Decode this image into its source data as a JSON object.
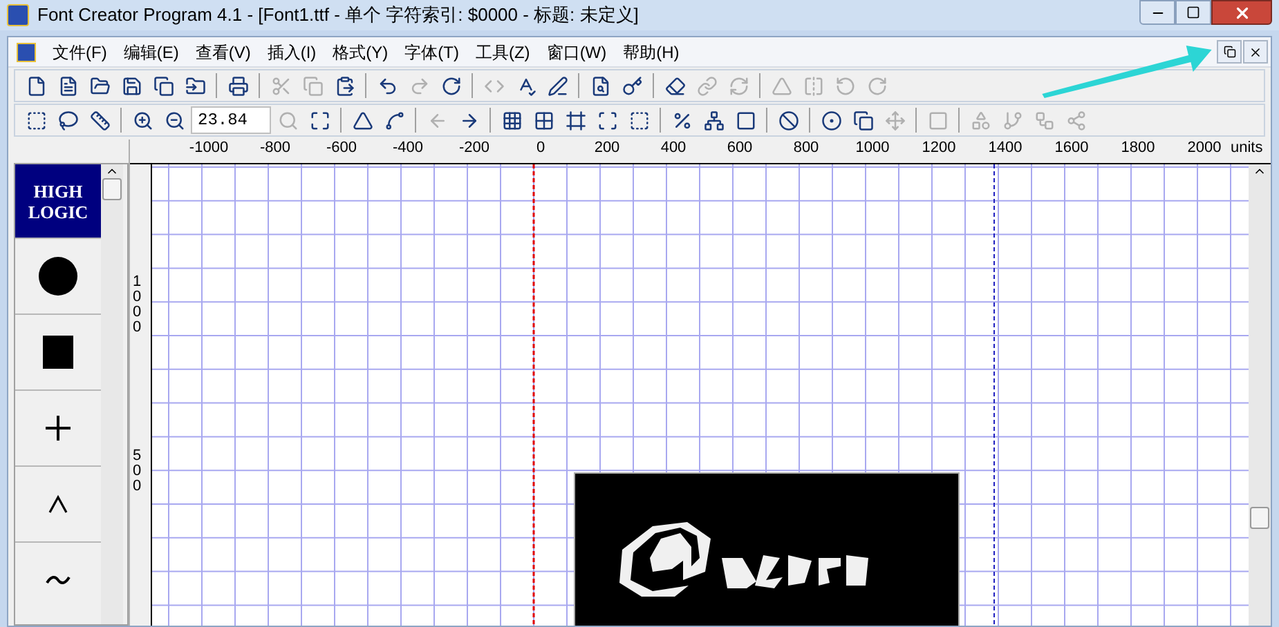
{
  "window": {
    "title": "Font Creator Program 4.1 - [Font1.ttf - 单个 字符索引: $0000 - 标题: 未定义]"
  },
  "menu": [
    "文件(F)",
    "编辑(E)",
    "查看(V)",
    "插入(I)",
    "格式(Y)",
    "字体(T)",
    "工具(Z)",
    "窗口(W)",
    "帮助(H)"
  ],
  "toolbar_1": [
    {
      "kind": "button",
      "disabled": false
    },
    {
      "kind": "button",
      "disabled": false
    },
    {
      "kind": "button",
      "disabled": false
    },
    {
      "kind": "button",
      "disabled": false
    },
    {
      "kind": "button",
      "disabled": false
    },
    {
      "kind": "button",
      "disabled": false
    },
    {
      "kind": "separator"
    },
    {
      "kind": "button",
      "disabled": false
    },
    {
      "kind": "separator"
    },
    {
      "kind": "button",
      "disabled": true
    },
    {
      "kind": "button",
      "disabled": true
    },
    {
      "kind": "button",
      "disabled": false
    },
    {
      "kind": "separator"
    },
    {
      "kind": "button",
      "disabled": false
    },
    {
      "kind": "button",
      "disabled": true
    },
    {
      "kind": "button",
      "disabled": false
    },
    {
      "kind": "separator"
    },
    {
      "kind": "button",
      "disabled": true
    },
    {
      "kind": "button",
      "disabled": false
    },
    {
      "kind": "button",
      "disabled": false
    },
    {
      "kind": "separator"
    },
    {
      "kind": "button",
      "disabled": false
    },
    {
      "kind": "button",
      "disabled": false
    },
    {
      "kind": "separator"
    },
    {
      "kind": "button",
      "disabled": false
    },
    {
      "kind": "button",
      "disabled": true
    },
    {
      "kind": "button",
      "disabled": true
    },
    {
      "kind": "separator"
    },
    {
      "kind": "button",
      "disabled": true
    },
    {
      "kind": "button",
      "disabled": true
    },
    {
      "kind": "button",
      "disabled": true
    },
    {
      "kind": "button",
      "disabled": true
    }
  ],
  "toolbar_2": [
    {
      "kind": "button",
      "disabled": false
    },
    {
      "kind": "button",
      "disabled": false
    },
    {
      "kind": "button",
      "disabled": false
    },
    {
      "kind": "separator"
    },
    {
      "kind": "button",
      "disabled": false
    },
    {
      "kind": "button",
      "disabled": false
    },
    {
      "kind": "field",
      "value": "23.84"
    },
    {
      "kind": "button",
      "disabled": true
    },
    {
      "kind": "button",
      "disabled": false
    },
    {
      "kind": "separator"
    },
    {
      "kind": "button",
      "disabled": false
    },
    {
      "kind": "button",
      "disabled": false
    },
    {
      "kind": "separator"
    },
    {
      "kind": "button",
      "disabled": true
    },
    {
      "kind": "button",
      "disabled": false
    },
    {
      "kind": "separator"
    },
    {
      "kind": "button",
      "disabled": false
    },
    {
      "kind": "button",
      "disabled": false
    },
    {
      "kind": "button",
      "disabled": false
    },
    {
      "kind": "button",
      "disabled": false
    },
    {
      "kind": "button",
      "disabled": false
    },
    {
      "kind": "separator"
    },
    {
      "kind": "button",
      "disabled": false
    },
    {
      "kind": "button",
      "disabled": false
    },
    {
      "kind": "button",
      "disabled": false
    },
    {
      "kind": "separator"
    },
    {
      "kind": "button",
      "disabled": false
    },
    {
      "kind": "separator"
    },
    {
      "kind": "button",
      "disabled": false
    },
    {
      "kind": "button",
      "disabled": false
    },
    {
      "kind": "button",
      "disabled": true
    },
    {
      "kind": "separator"
    },
    {
      "kind": "button",
      "disabled": true
    },
    {
      "kind": "separator"
    },
    {
      "kind": "button",
      "disabled": true
    },
    {
      "kind": "button",
      "disabled": true
    },
    {
      "kind": "button",
      "disabled": true
    },
    {
      "kind": "button",
      "disabled": true
    }
  ],
  "ruler": {
    "labels": [
      "-1000",
      "-800",
      "-600",
      "-400",
      "-200",
      "0",
      "200",
      "400",
      "600",
      "800",
      "1000",
      "1200",
      "1400",
      "1600",
      "1800",
      "2000"
    ],
    "unit": "units",
    "vertical_labels": [
      "1000",
      "500"
    ]
  },
  "sidebar": {
    "logo": "HIGH LOGIC",
    "items": [
      {
        "kind": "circle"
      },
      {
        "kind": "square"
      },
      {
        "kind": "plus"
      },
      {
        "kind": "caret"
      },
      {
        "kind": "tilde"
      }
    ]
  }
}
